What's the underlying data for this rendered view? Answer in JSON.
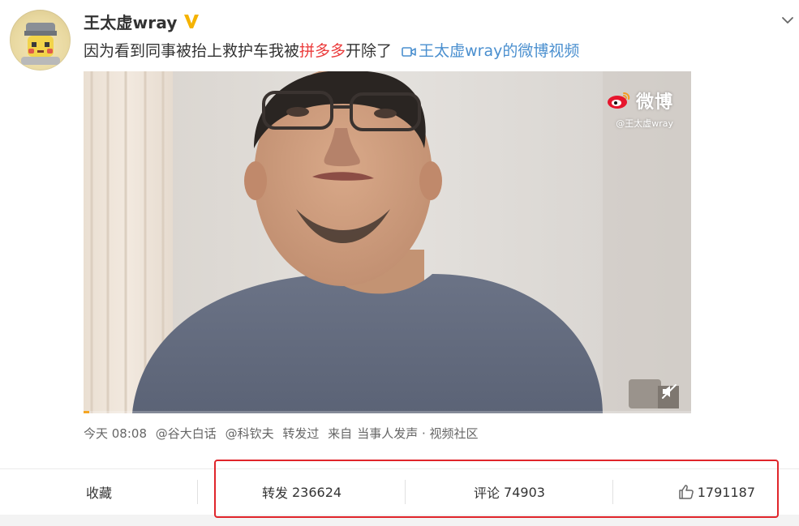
{
  "post": {
    "username": "王太虚wray",
    "text_before": "因为看到同事被抬上救护车我被",
    "text_highlight": "拼多多",
    "text_after": "开除了",
    "video_link_label": "王太虚wray的微博视频"
  },
  "video": {
    "watermark_brand": "微博",
    "watermark_handle": "@王太虚wray",
    "progress_percent": 1
  },
  "meta": {
    "time": "今天 08:08",
    "mention_1": "@谷大白话",
    "mention_2": "@科钦夫",
    "forwarded": "转发过",
    "source_prefix": "来自",
    "source": "当事人发声 · 视频社区"
  },
  "actions": {
    "favorite_label": "收藏",
    "forward_label": "转发",
    "forward_count": "236624",
    "comment_label": "评论",
    "comment_count": "74903",
    "like_count": "1791187"
  },
  "icons": {
    "verified": "verified-v-icon",
    "chevron": "chevron-down-icon",
    "video_camera": "video-camera-icon",
    "weibo_logo": "weibo-logo-icon",
    "mute": "mute-icon",
    "thumbs_up": "thumbs-up-icon"
  },
  "colors": {
    "link_blue": "#4a8fcf",
    "highlight_red": "#eb3b3b",
    "verified_gold": "#f5b300",
    "annotation_box": "#e0252b"
  }
}
